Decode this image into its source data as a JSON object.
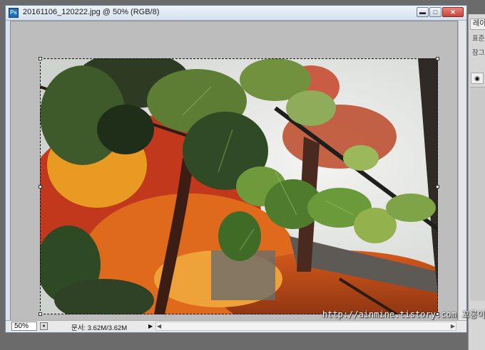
{
  "window": {
    "title": "20161106_120222.jpg @ 50% (RGB/8)",
    "app_icon_text": "Ps",
    "minimize_icon": "minimize-icon",
    "maximize_icon": "maximize-icon",
    "close_icon": "close-icon"
  },
  "status": {
    "zoom": "50%",
    "doc_info": "문서: 3.62M/3.62M"
  },
  "panel": {
    "tab_label": "레이",
    "row1": "표준",
    "row2": "잠그"
  },
  "watermark": "http://ainmine.tistory.com 꼬롱이",
  "colors": {
    "accent": "#1f6fb3",
    "canvas_bg": "#bdbdbd",
    "close_button": "#c7453a"
  }
}
